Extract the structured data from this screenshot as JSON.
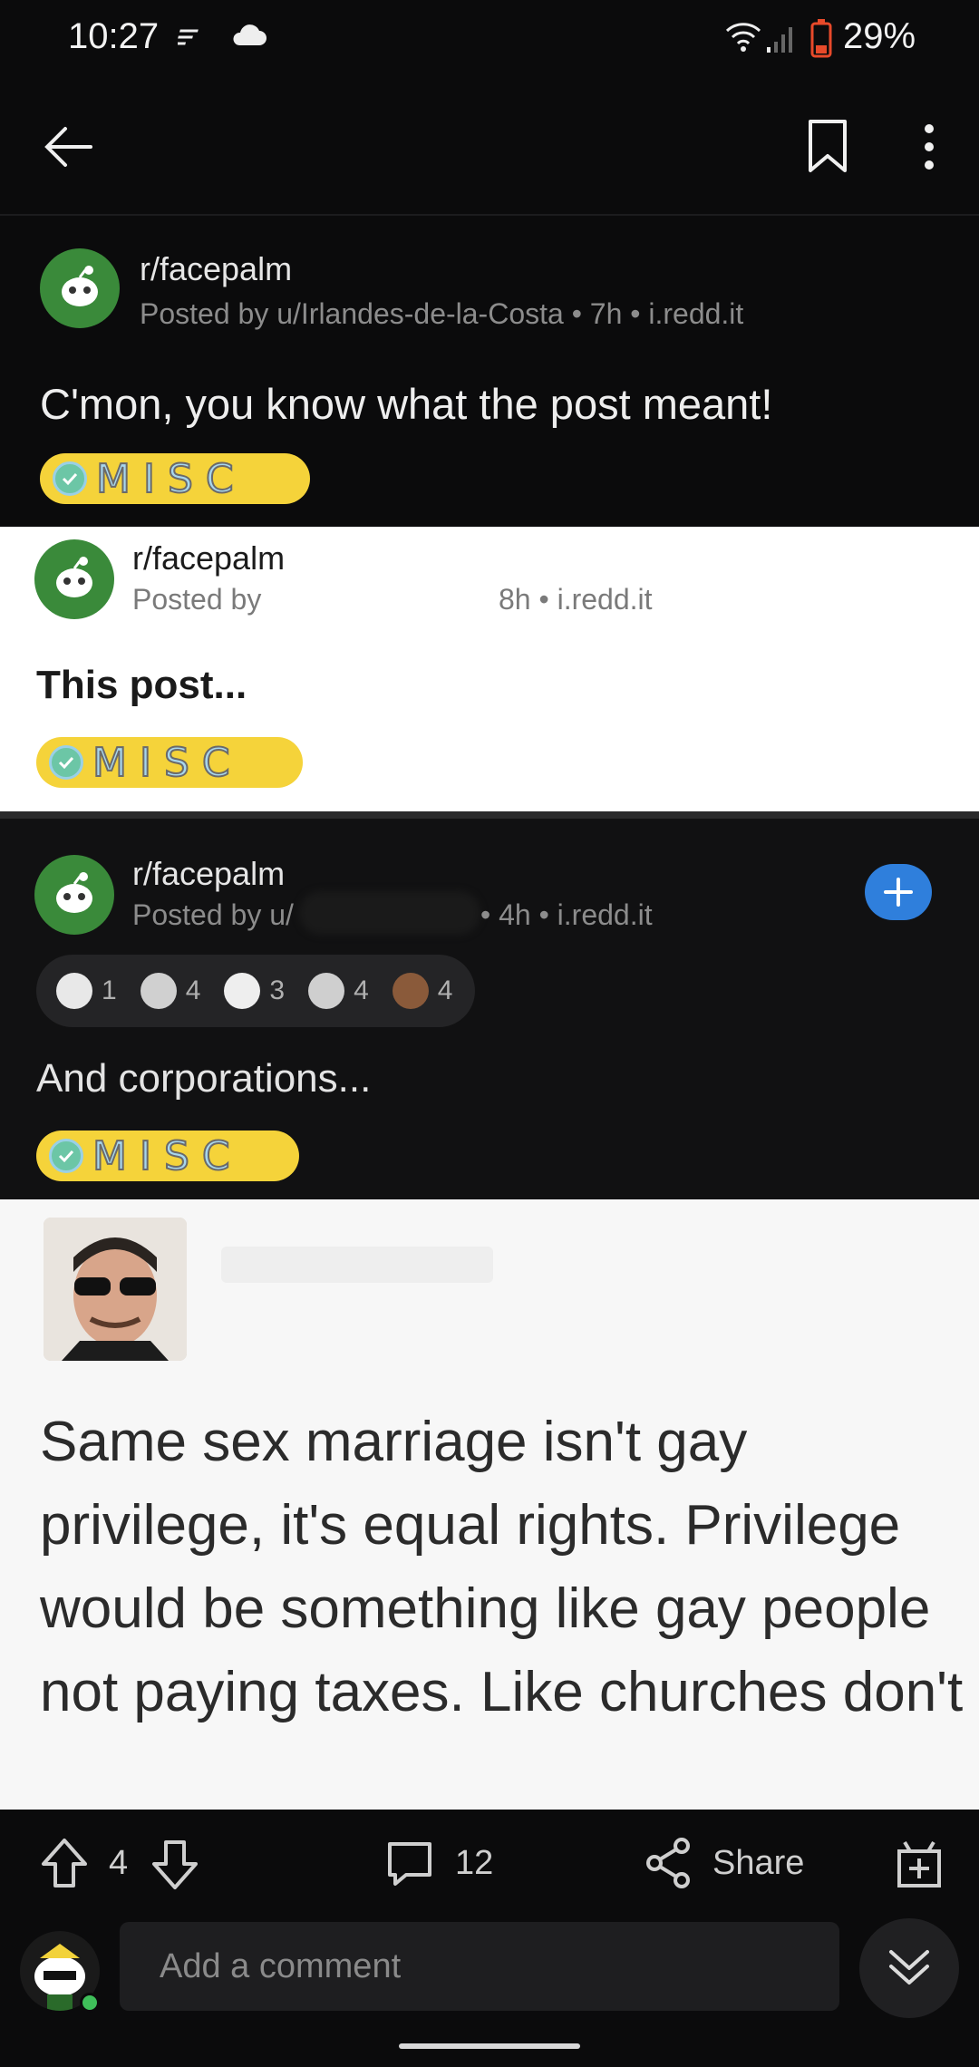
{
  "status": {
    "time": "10:27",
    "battery": "29%"
  },
  "post": {
    "subreddit": "r/facepalm",
    "meta": "Posted by u/Irlandes-de-la-Costa • 7h • i.redd.it",
    "title": "C'mon, you know what the post meant!",
    "flair": "MISC"
  },
  "embed1": {
    "subreddit": "r/facepalm",
    "posted_by": "Posted by",
    "meta_right": "8h • i.redd.it",
    "title": "This post...",
    "flair": "MISC"
  },
  "embed2": {
    "subreddit": "r/facepalm",
    "posted_by": "Posted by u/",
    "meta_right": "• 4h • i.redd.it",
    "awards": [
      {
        "icon": "award-wholesome-icon",
        "count": "1",
        "color": "#e8e8e8"
      },
      {
        "icon": "award-helpful-icon",
        "count": "4",
        "color": "#d0d0d0"
      },
      {
        "icon": "award-laugh-icon",
        "count": "3",
        "color": "#eeeeee"
      },
      {
        "icon": "award-silver-icon",
        "count": "4",
        "color": "#cfcfcf"
      },
      {
        "icon": "award-bear-icon",
        "count": "4",
        "color": "#8a5a3a"
      }
    ],
    "title": "And corporations...",
    "flair": "MISC"
  },
  "tweet": {
    "text": "Same sex marriage isn't gay privilege, it's equal rights. Privilege would be something like gay people not paying taxes. Like churches don't"
  },
  "actions": {
    "votes": "4",
    "comments": "12",
    "share": "Share"
  },
  "comment": {
    "placeholder": "Add a comment"
  },
  "colors": {
    "accent": "#2f7fdc",
    "flair": "#f5d33a",
    "avatar": "#3a8a3a"
  }
}
